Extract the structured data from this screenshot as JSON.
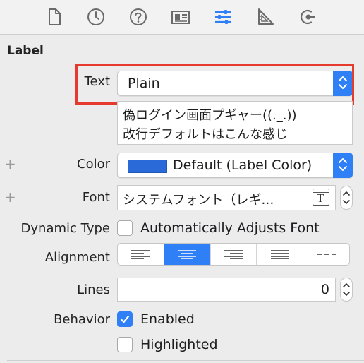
{
  "toolbar": {
    "icons": [
      "file-inspector-icon",
      "history-inspector-icon",
      "quick-help-icon",
      "identity-inspector-icon",
      "attributes-inspector-icon",
      "size-inspector-icon",
      "connections-inspector-icon"
    ],
    "active_color": "#2f7ff7",
    "inactive_color": "#6b6b6b"
  },
  "section": {
    "title": "Label"
  },
  "text_row": {
    "label": "Text",
    "value": "Plain",
    "content_lines": [
      "偽ログイン画面プギャー((._.))",
      "改行デフォルトはこんな感じ"
    ],
    "highlight_color": "#e63a2e"
  },
  "color_row": {
    "label": "Color",
    "value": "Default (Label Color)",
    "swatch_color": "#2a6ad8"
  },
  "font_row": {
    "label": "Font",
    "value": "システムフォント（レギ…"
  },
  "dynamic_type_row": {
    "label": "Dynamic Type",
    "checkbox_label": "Automatically Adjusts Font",
    "checked": false
  },
  "alignment_row": {
    "label": "Alignment",
    "options": [
      "left",
      "center",
      "right",
      "justified",
      "natural"
    ],
    "selected": "center"
  },
  "lines_row": {
    "label": "Lines",
    "value": "0"
  },
  "behavior_row": {
    "label": "Behavior",
    "enabled_label": "Enabled",
    "enabled_checked": true,
    "highlighted_label": "Highlighted",
    "highlighted_checked": false
  },
  "plus_symbol": "+"
}
